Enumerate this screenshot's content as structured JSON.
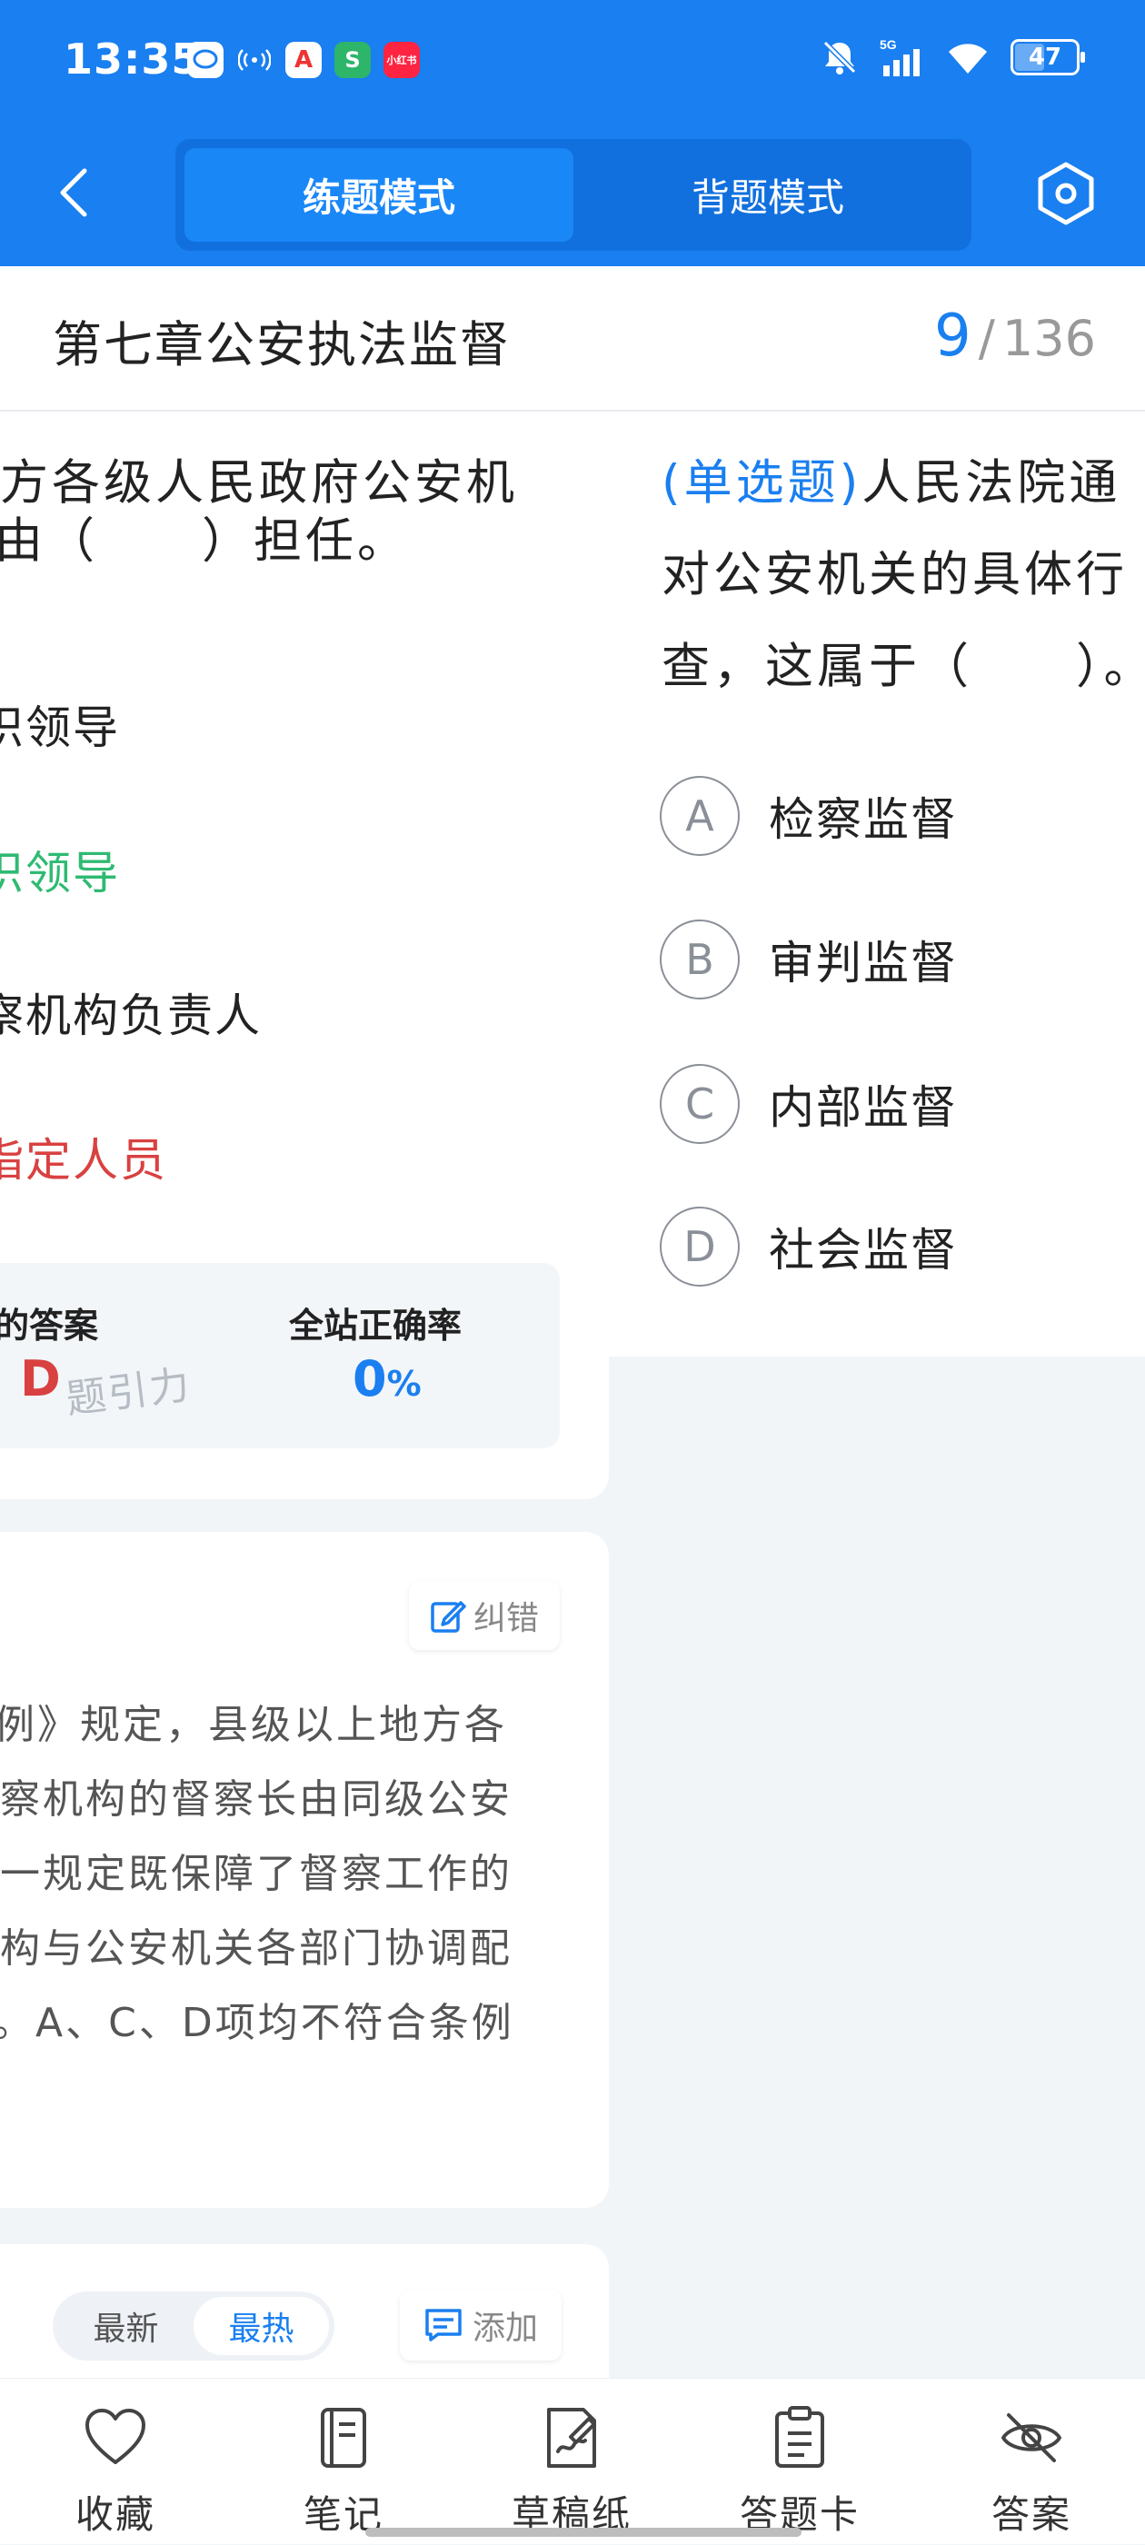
{
  "status_bar": {
    "time": "13:35",
    "battery": "47",
    "network": "5G"
  },
  "header": {
    "modes": [
      "练题模式",
      "背题模式"
    ],
    "active_mode": 0
  },
  "chapter": {
    "title": "第七章公安执法监督",
    "current": "9",
    "total": "136"
  },
  "previous_question": {
    "lines": [
      "方各级人民政府公安机",
      "由（　　）担任。"
    ],
    "options": [
      {
        "text": "织领导",
        "state": "normal"
      },
      {
        "text": "织领导",
        "state": "correct"
      },
      {
        "text": "察机构负责人",
        "state": "normal"
      },
      {
        "text": "指定人员",
        "state": "wrong"
      }
    ],
    "stats": {
      "my_answer_label": "的答案",
      "my_answer": "D",
      "watermark": "题引力",
      "accuracy_label": "全站正确率",
      "accuracy_value": "0",
      "accuracy_unit": "%"
    },
    "analysis": {
      "correct_label": "纠错",
      "lines": [
        "例》规定，县级以上地方各",
        "察机构的督察长由同级公安",
        "一规定既保障了督察工作的",
        "构与公安机关各部门协调配",
        "。A、C、D项均不符合条例"
      ]
    },
    "comments": {
      "sort_options": [
        "最新",
        "最热"
      ],
      "active_sort": 1,
      "add_label": "添加"
    }
  },
  "current_question": {
    "type_label": "(单选题)",
    "lines": [
      "人民法院通",
      "对公安机关的具体行",
      "查，这属于（　　）。"
    ],
    "options": [
      {
        "letter": "A",
        "text": "检察监督"
      },
      {
        "letter": "B",
        "text": "审判监督"
      },
      {
        "letter": "C",
        "text": "内部监督"
      },
      {
        "letter": "D",
        "text": "社会监督"
      }
    ]
  },
  "bottom_nav": [
    {
      "label": "收藏",
      "icon": "heart-icon"
    },
    {
      "label": "笔记",
      "icon": "notebook-icon"
    },
    {
      "label": "草稿纸",
      "icon": "draft-paper-icon"
    },
    {
      "label": "答题卡",
      "icon": "answer-card-icon"
    },
    {
      "label": "答案",
      "icon": "eye-off-icon"
    }
  ],
  "colors": {
    "primary": "#1a7ff0",
    "correct": "#2fba72",
    "wrong": "#d94141"
  }
}
